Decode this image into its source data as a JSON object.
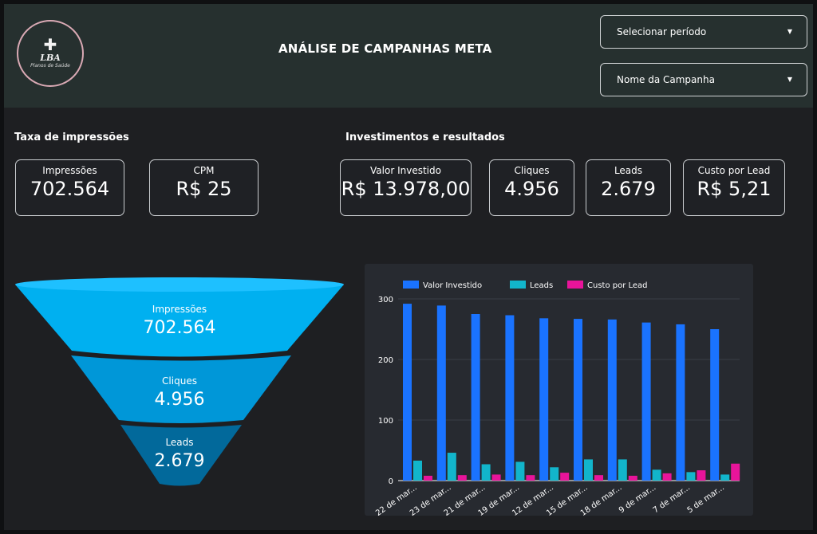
{
  "header": {
    "title": "ANÁLISE DE CAMPANHAS META",
    "logo": {
      "brand": "LBA",
      "subtitle": "Planos de Saúde"
    },
    "filters": {
      "period": "Selecionar período",
      "campaign": "Nome da Campanha"
    }
  },
  "sections": {
    "impressions": "Taxa de impressões",
    "investments": "Investimentos e resultados"
  },
  "kpis": {
    "impressions": {
      "label": "Impressões",
      "value": "702.564"
    },
    "cpm": {
      "label": "CPM",
      "value": "R$ 25"
    },
    "invested": {
      "label": "Valor Investido",
      "value": "R$ 13.978,00"
    },
    "clicks": {
      "label": "Cliques",
      "value": "4.956"
    },
    "leads": {
      "label": "Leads",
      "value": "2.679"
    },
    "cpl": {
      "label": "Custo por Lead",
      "value": "R$ 5,21"
    }
  },
  "funnel": {
    "stages": [
      {
        "label": "Impressões",
        "value": "702.564"
      },
      {
        "label": "Cliques",
        "value": "4.956"
      },
      {
        "label": "Leads",
        "value": "2.679"
      }
    ]
  },
  "colors": {
    "invested": "#1a73ff",
    "leads": "#12b5cb",
    "cpl": "#e8149a",
    "funnel_top": "#00b0f0",
    "funnel_mid": "#0097d8",
    "funnel_bot": "#02699b"
  },
  "chart_data": {
    "type": "bar",
    "categories": [
      "22 de mar...",
      "23 de mar...",
      "21 de mar...",
      "19 de mar...",
      "12 de mar...",
      "15 de mar...",
      "18 de mar...",
      "9 de mar...",
      "7 de mar...",
      "5 de mar..."
    ],
    "series": [
      {
        "name": "Valor Investido",
        "values": [
          292,
          289,
          275,
          273,
          268,
          267,
          266,
          261,
          258,
          250
        ]
      },
      {
        "name": "Leads",
        "values": [
          33,
          46,
          27,
          31,
          22,
          35,
          35,
          18,
          14,
          10
        ]
      },
      {
        "name": "Custo por Lead",
        "values": [
          8,
          9,
          10,
          9,
          13,
          9,
          8,
          12,
          17,
          28
        ]
      }
    ],
    "ylim": [
      0,
      300
    ],
    "yticks": [
      0,
      100,
      200,
      300
    ],
    "legend": "top-left",
    "grid": true
  }
}
